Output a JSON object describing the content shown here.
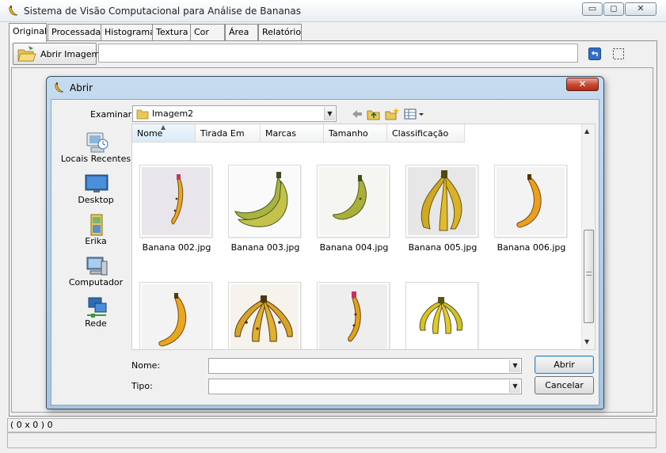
{
  "app": {
    "title": "Sistema de Visão Computacional para Análise de Bananas",
    "window_buttons": {
      "minimize": "▭",
      "restore": "◻",
      "close": "✕"
    }
  },
  "tabs": [
    {
      "label": "Original",
      "active": true
    },
    {
      "label": "Processada"
    },
    {
      "label": "Histograma"
    },
    {
      "label": "Textura"
    },
    {
      "label": "Cor"
    },
    {
      "label": "Área"
    },
    {
      "label": "Relatório"
    }
  ],
  "toolbar": {
    "open_image_label": "Abrir Imagem",
    "path_value": "",
    "icons": [
      "undo-icon",
      "selection-icon"
    ]
  },
  "statusbar": {
    "coords": "( 0 x 0 ) 0",
    "message": ""
  },
  "dialog": {
    "title": "Abrir",
    "close_label": "✕",
    "look_in_label": "Examinar:",
    "look_in_value": "Imagem2",
    "places": [
      {
        "label": "Locais Recentes",
        "icon": "recent-places-icon"
      },
      {
        "label": "Desktop",
        "icon": "desktop-icon"
      },
      {
        "label": "Erika",
        "icon": "user-folder-icon"
      },
      {
        "label": "Computador",
        "icon": "computer-icon"
      },
      {
        "label": "Rede",
        "icon": "network-icon"
      }
    ],
    "columns": [
      "Nome",
      "Tirada Em",
      "Marcas",
      "Tamanho",
      "Classificação"
    ],
    "files": [
      {
        "name": "Banana 002.jpg"
      },
      {
        "name": "Banana 003.jpg"
      },
      {
        "name": "Banana 004.jpg"
      },
      {
        "name": "Banana 005.jpg"
      },
      {
        "name": "Banana 006.jpg"
      },
      {
        "name": ""
      },
      {
        "name": ""
      },
      {
        "name": ""
      },
      {
        "name": ""
      }
    ],
    "file_name_label": "Nome:",
    "file_name_value": "",
    "file_type_label": "Tipo:",
    "file_type_value": "",
    "open_button": "Abrir",
    "cancel_button": "Cancelar"
  },
  "colors": {
    "banana_yellow": "#e8b923",
    "banana_green": "#8fa83a",
    "dialog_frame": "#b9d1ea",
    "close_red": "#c8452f"
  }
}
